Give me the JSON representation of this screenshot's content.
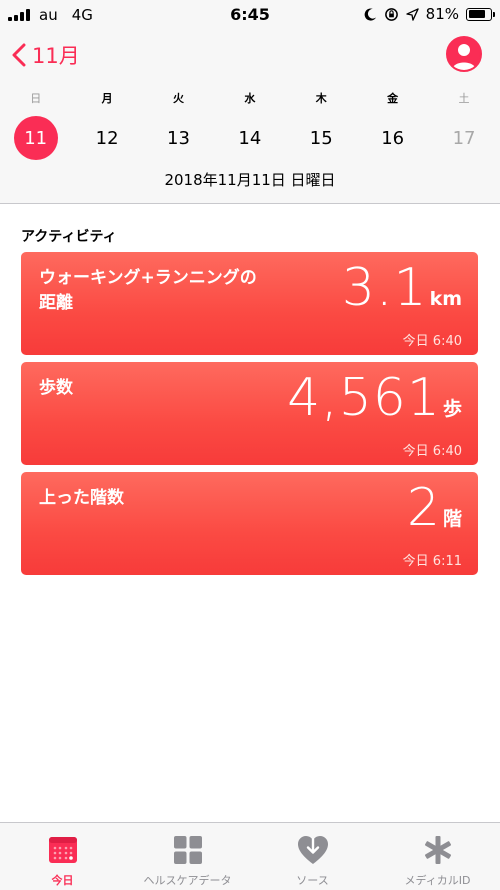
{
  "status_bar": {
    "carrier": "au",
    "network": "4G",
    "time": "6:45",
    "battery": "81%",
    "battery_level": 0.81
  },
  "header": {
    "back_label": "11月"
  },
  "calendar": {
    "weekdays": [
      "日",
      "月",
      "火",
      "水",
      "木",
      "金",
      "土"
    ],
    "dates": [
      "11",
      "12",
      "13",
      "14",
      "15",
      "16",
      "17"
    ],
    "selected_index": 0,
    "selected_date": "2018年11月11日 日曜日"
  },
  "section": {
    "title": "アクティビティ"
  },
  "cards": [
    {
      "label_line1": "ウォーキング+ランニングの",
      "label_line2": "距離",
      "value": "3.1",
      "unit": "km",
      "time": "今日 6:40"
    },
    {
      "label_line1": "歩数",
      "value": "4,561",
      "unit": "歩",
      "time": "今日 6:40"
    },
    {
      "label_line1": "上った階数",
      "value": "2",
      "unit": "階",
      "time": "今日 6:11"
    }
  ],
  "tabs": [
    {
      "label": "今日",
      "icon": "calendar-today-icon",
      "active": true
    },
    {
      "label": "ヘルスケアデータ",
      "icon": "grid-icon",
      "active": false
    },
    {
      "label": "ソース",
      "icon": "heart-download-icon",
      "active": false
    },
    {
      "label": "メディカルID",
      "icon": "asterisk-icon",
      "active": false
    }
  ],
  "colors": {
    "accent": "#fa2d55",
    "card": "#fb4a43"
  }
}
